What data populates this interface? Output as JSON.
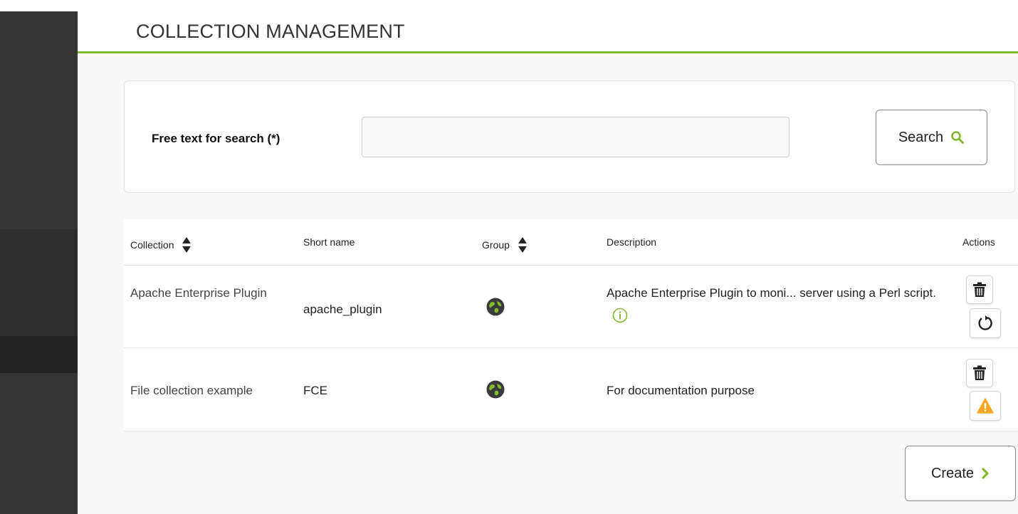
{
  "page": {
    "title": "COLLECTION MANAGEMENT",
    "accent_color": "#82b92e"
  },
  "search": {
    "label": "Free text for search (*)",
    "value": "",
    "placeholder": "",
    "button_label": "Search",
    "button_icon": "search-icon"
  },
  "table": {
    "columns": [
      "Collection",
      "Short name",
      "Group",
      "Description",
      "Actions"
    ],
    "sortable_columns": [
      "Collection",
      "Group"
    ],
    "rows": [
      {
        "collection": "Apache Enterprise Plugin",
        "short_name": "apache_plugin",
        "group_icon": "globe-icon",
        "description": "Apache Enterprise Plugin to moni... server using a Perl script.",
        "actions": [
          "trash-icon",
          "refresh-icon"
        ]
      },
      {
        "collection": "File collection example",
        "short_name": "FCE",
        "group_icon": "globe-icon",
        "description": "For documentation purpose",
        "actions": [
          "trash-icon",
          "warning-icon"
        ]
      }
    ]
  },
  "footer": {
    "create_label": "Create",
    "create_icon": "chevron-right-icon"
  }
}
